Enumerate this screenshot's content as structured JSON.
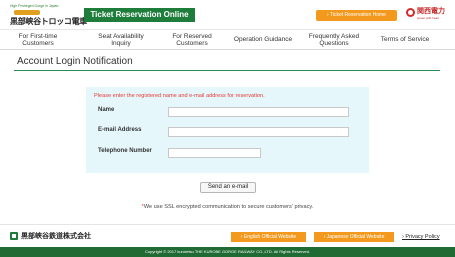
{
  "header": {
    "logo_tagline": "High Privileged Gorge in Japan",
    "logo_name": "黒部峡谷トロッコ電車",
    "brand_title": "Ticket Reservation Online",
    "ticket_home_label": "Ticket Reservation Home",
    "partner_logo_text": "関西電力",
    "partner_logo_sub": "power with heart"
  },
  "nav": {
    "items": [
      {
        "label": "For First-time Customers"
      },
      {
        "label": "Seat Availability Inquiry"
      },
      {
        "label": "For Reserved Customers"
      },
      {
        "label": "Operation Guidance"
      },
      {
        "label": "Frequently Asked Questions"
      },
      {
        "label": "Terms of Service"
      }
    ]
  },
  "main": {
    "title": "Account Login Notification",
    "instruction": "Please enter the registered name and e-mail address for reservation.",
    "fields": {
      "name": {
        "label": "Name",
        "value": ""
      },
      "email": {
        "label": "E-mail Address",
        "value": ""
      },
      "phone": {
        "label": "Telephone Number",
        "value": ""
      }
    },
    "send_label": "Send an e-mail",
    "ssl_star": "*",
    "ssl_note": "We use SSL encrypted communication to secure customers' privacy."
  },
  "footer": {
    "company_name": "黒部峡谷鉄道株式会社",
    "official_en": "English Official Website",
    "official_jp": "Japanese Official Website",
    "privacy": "Privacy Policy",
    "copyright": "Copyright © 2017 kurotetsu THE KUROBE GORGE RAILWAY CO.,LTD. All Rights Reserved."
  },
  "colors": {
    "brand_green": "#1e7d3a",
    "accent_orange": "#f39a1e",
    "form_bg": "#e6f7fb",
    "alert_red": "#e53935"
  }
}
